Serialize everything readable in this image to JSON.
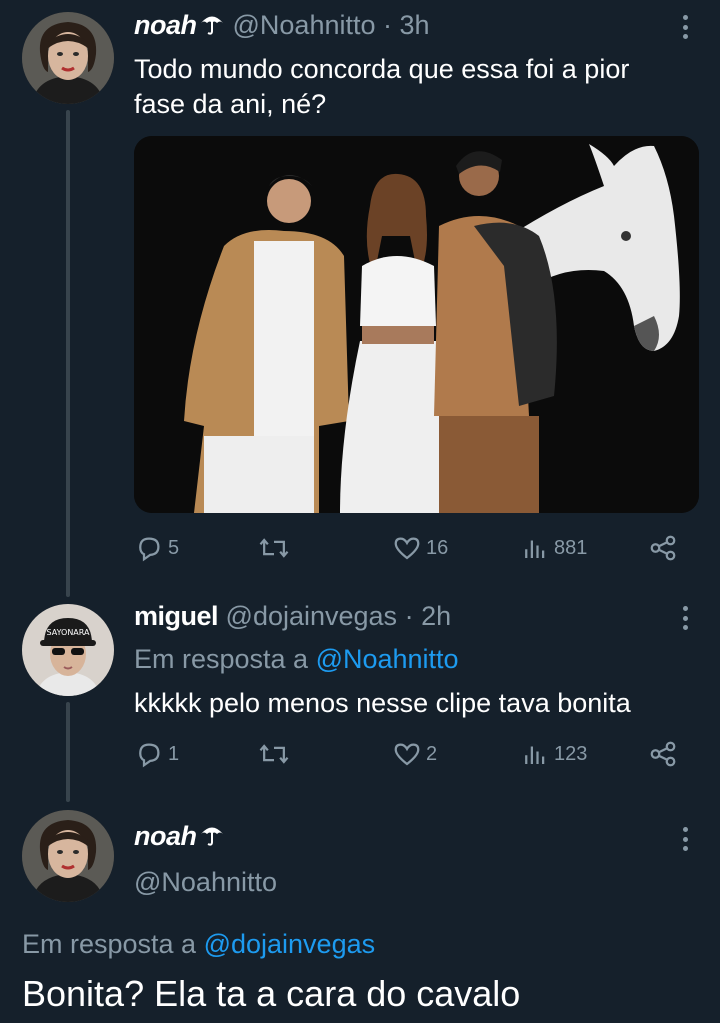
{
  "colors": {
    "background": "#15202b",
    "muted": "#8899a6",
    "link": "#1d9bf0",
    "thread_line": "#38444d"
  },
  "tweet1": {
    "name": "noah",
    "handle": "@Noahnitto",
    "sep": " · ",
    "time": "3h",
    "text_line1": "Todo mundo concorda que essa foi a pior",
    "text_line2": "fase da ani, né?",
    "name_icon": "umbrella-icon",
    "replies": "5",
    "likes": "16",
    "views": "881"
  },
  "tweet2": {
    "name": "miguel",
    "handle": "@dojainvegas",
    "sep": " · ",
    "time": "2h",
    "reply_prefix": "Em resposta a ",
    "reply_handle": "@Noahnitto",
    "text": "kkkkk pelo menos nesse clipe tava bonita",
    "replies": "1",
    "likes": "2",
    "views": "123"
  },
  "tweet3": {
    "name": "noah",
    "handle": "@Noahnitto",
    "name_icon": "umbrella-icon",
    "reply_prefix": "Em resposta a ",
    "reply_handle": "@dojainvegas",
    "text": "Bonita? Ela ta a cara do cavalo"
  },
  "icons": {
    "reply": "reply-icon",
    "retweet": "retweet-icon",
    "like": "heart-icon",
    "views": "views-icon",
    "share": "share-icon",
    "more": "more-icon"
  }
}
